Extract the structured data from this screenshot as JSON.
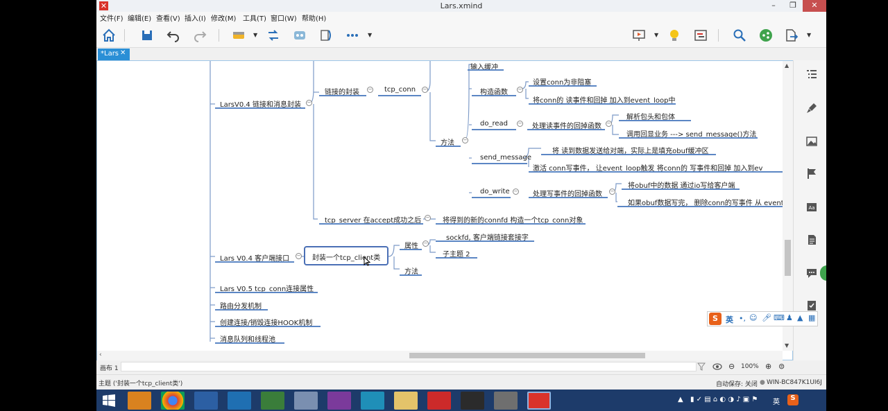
{
  "window": {
    "title": "Lars.xmind",
    "minimize": "–",
    "restore": "❐",
    "close": "✕"
  },
  "menu": [
    "文件(F)",
    "编辑(E)",
    "查看(V)",
    "插入(I)",
    "修改(M)",
    "工具(T)",
    "窗口(W)",
    "帮助(H)"
  ],
  "tab": {
    "label": "*Lars",
    "close": "✕"
  },
  "mindmap": {
    "n_input_buffer": "输入缓冲",
    "v04_link": "LarsV0.4 链接和消息封装",
    "link_encap": "链接的封装",
    "tcp_conn": "tcp_conn",
    "ctor": "构造函数",
    "ctor_1": "设置conn为非阻塞",
    "ctor_2": "将conn的 读事件和回掉 加入到event_loop中",
    "method": "方法",
    "do_read": "do_read",
    "do_read_cb": "处理读事件的回掉函数",
    "do_read_1": "解析包头和包体",
    "do_read_2": "调用回显业务 ---> send_message()方法",
    "send_message": "send_message",
    "send_1": "将 读到数据发送给对端，实际上是填充obuf缓冲区",
    "send_2": "激活 conn写事件， 让event_loop触发   将conn的 写事件和回掉 加入到ev",
    "do_write": "do_write",
    "do_write_cb": "处理写事件的回掉函数",
    "do_write_1": "将obuf中的数据 通过io写给客户端",
    "do_write_2": "如果obuf数据写完， 删除conn的写事件 从 event_",
    "tcp_server": "tcp_server 在accept成功之后",
    "tcp_server_1": "将得到的新的connfd 构造一个tcp_conn对象",
    "v04_client": "Lars V0.4 客户端接口",
    "client_class": "封装一个tcp_client类",
    "attr": "属性",
    "sockfd": "_sockfd, 客户端链接套接字",
    "subtopic2": "子主题 2",
    "method2": "方法",
    "v05": "Lars V0.5 tcp_conn连接属性",
    "routing": "路由分发机制",
    "hook": "创建连接/销毁连接HOOK机制",
    "mq": "消息队列和线程池"
  },
  "canvas_status": {
    "sheet": "画布 1",
    "zoom": "100%"
  },
  "bottom_status": {
    "left": "主题 ('封装一个tcp_client类')",
    "autosave": "自动保存: 关闭",
    "host": "WIN-BC847K1UI6J"
  },
  "ime": {
    "lang": "英",
    "brand": "S"
  },
  "tray": {
    "lang": "英",
    "brand": "S"
  },
  "colors": {
    "accent": "#2a8fd6",
    "branch": "#5b86c4",
    "selected": "#4a6fb5",
    "taskbar": "#1d3b6a"
  }
}
